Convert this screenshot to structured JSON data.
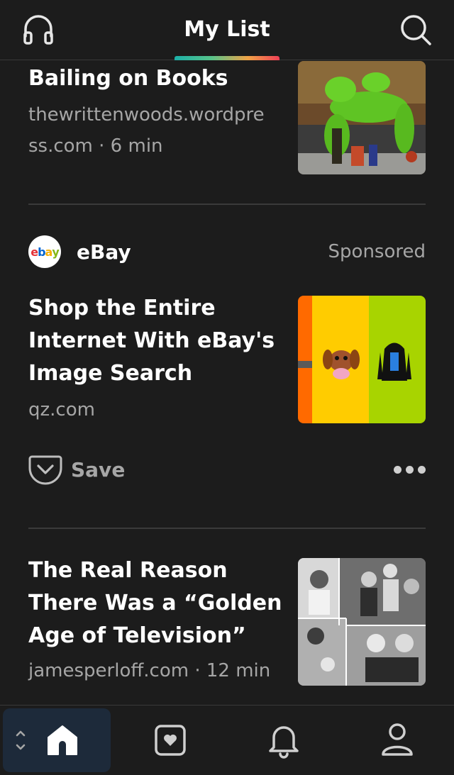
{
  "header": {
    "title": "My List",
    "left_icon": "headphones-icon",
    "right_icon": "search-icon",
    "indicator_colors": [
      "#1cb0a8",
      "#57c38a",
      "#f0a347",
      "#ef4056"
    ]
  },
  "items": [
    {
      "title": "Bailing on Books",
      "meta_line1": "thewrittenwoods.wordpre",
      "meta_line2": "ss.com · 6 min"
    },
    {
      "sponsor": {
        "name": "eBay",
        "logo_text": "ebay",
        "label": "Sponsored"
      },
      "title_line1": "Shop the Entire",
      "title_line2": "Internet With eBay's",
      "title_line3": "Image Search",
      "domain": "qz.com",
      "save_label": "Save",
      "thumb_colors": [
        "#ff6a00",
        "#ffcc00",
        "#a8d400"
      ]
    },
    {
      "title_line1": "The Real Reason",
      "title_line2": "There Was a “Golden",
      "title_line3": "Age of Television”",
      "meta": "jamesperloff.com · 12 min"
    }
  ],
  "bottom_nav": {
    "items": [
      "home-icon",
      "saves-icon",
      "bell-icon",
      "profile-icon"
    ],
    "active_bg": "#1d2a3a"
  }
}
